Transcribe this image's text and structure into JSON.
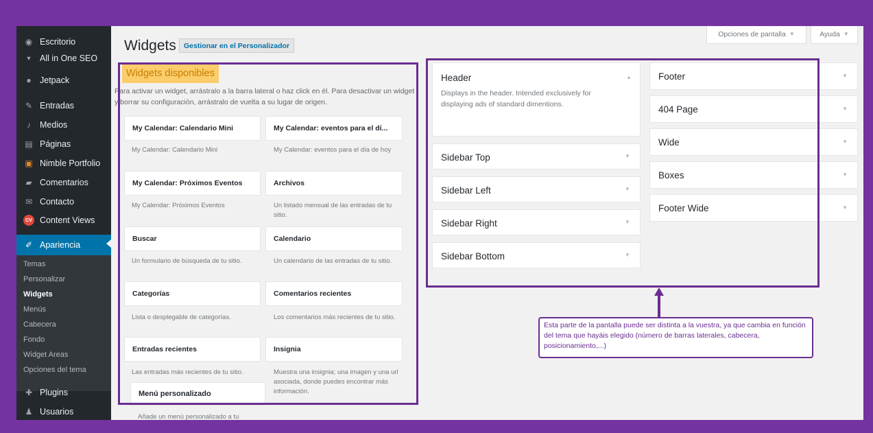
{
  "menu": [
    {
      "label": "Escritorio",
      "icon": "dashboard-icon",
      "glyph": "◉"
    },
    {
      "label": "All in One SEO",
      "icon": "seo-icon",
      "glyph": "▼"
    },
    {
      "label": "Jetpack",
      "icon": "jetpack-icon",
      "glyph": "●"
    },
    {
      "label": "Entradas",
      "icon": "pin-icon",
      "glyph": "✎"
    },
    {
      "label": "Medios",
      "icon": "media-icon",
      "glyph": "♪"
    },
    {
      "label": "Páginas",
      "icon": "pages-icon",
      "glyph": "▤"
    },
    {
      "label": "Nimble Portfolio",
      "icon": "portfolio-icon",
      "glyph": "▣"
    },
    {
      "label": "Comentarios",
      "icon": "comments-icon",
      "glyph": "▰"
    },
    {
      "label": "Contacto",
      "icon": "mail-icon",
      "glyph": "✉"
    },
    {
      "label": "Content Views",
      "icon": "content-views-icon",
      "glyph": "CV"
    },
    {
      "label": "Apariencia",
      "icon": "brush-icon",
      "glyph": "✐"
    },
    {
      "label": "Plugins",
      "icon": "plugin-icon",
      "glyph": "✚"
    },
    {
      "label": "Usuarios",
      "icon": "user-icon",
      "glyph": "♟"
    }
  ],
  "submenu": [
    "Temas",
    "Personalizar",
    "Widgets",
    "Menús",
    "Cabecera",
    "Fondo",
    "Widget Areas",
    "Opciones del tema"
  ],
  "page": {
    "title": "Widgets",
    "manage_label": "Gestionar en el Personalizador",
    "screen_options": "Opciones de pantalla",
    "help": "Ayuda"
  },
  "available": {
    "title": "Widgets disponibles",
    "desc": "Para activar un widget, arrástralo a la barra lateral o haz click en él. Para desactivar un widget y borrar su configuración, arrástralo de vuelta a su lugar de origen."
  },
  "widgets": [
    {
      "name": "My Calendar: Calendario Mini",
      "desc": "My Calendar: Calendario Mini"
    },
    {
      "name": "My Calendar: eventos para el dí...",
      "desc": "My Calendar: eventos para el día de hoy"
    },
    {
      "name": "My Calendar: Próximos Eventos",
      "desc": "My Calendar: Próximos Eventos"
    },
    {
      "name": "Archivos",
      "desc": "Un listado mensual de las entradas de tu sitio."
    },
    {
      "name": "Buscar",
      "desc": "Un formulario de búsqueda de tu sitio."
    },
    {
      "name": "Calendario",
      "desc": "Un calendario de las entradas de tu sitio."
    },
    {
      "name": "Categorías",
      "desc": "Lista o desplegable de categorías."
    },
    {
      "name": "Comentarios recientes",
      "desc": "Los comentarios más recientes de tu sitio."
    },
    {
      "name": "Entradas recientes",
      "desc": "Las entradas más recientes de tu sitio."
    },
    {
      "name": "Insignia",
      "desc": "Muestra una insignia; una imagen y una url asociada, donde puedes encontrar más información."
    },
    {
      "name": "Menú personalizado",
      "desc": "Añade un menú personalizado a tu"
    }
  ],
  "sidebars_left": [
    {
      "name": "Header",
      "desc": "Displays in the header. Intended exclusively for displaying ads of standard dimentions."
    },
    {
      "name": "Sidebar Top"
    },
    {
      "name": "Sidebar Left"
    },
    {
      "name": "Sidebar Right"
    },
    {
      "name": "Sidebar Bottom"
    }
  ],
  "sidebars_right": [
    {
      "name": "Footer"
    },
    {
      "name": "404 Page"
    },
    {
      "name": "Wide"
    },
    {
      "name": "Boxes"
    },
    {
      "name": "Footer Wide"
    }
  ],
  "annotation": "Esta parte de la pantalla puede ser distinta a la vuestra, ya que cambia en función del tema que hayáis elegido (número de barras laterales, cabecera, posicionamiento,...)",
  "colors": {
    "frame": "#7433a0",
    "accent": "#0073aa",
    "annotation": "#6a2d90",
    "highlight": "#fbcd6b"
  }
}
